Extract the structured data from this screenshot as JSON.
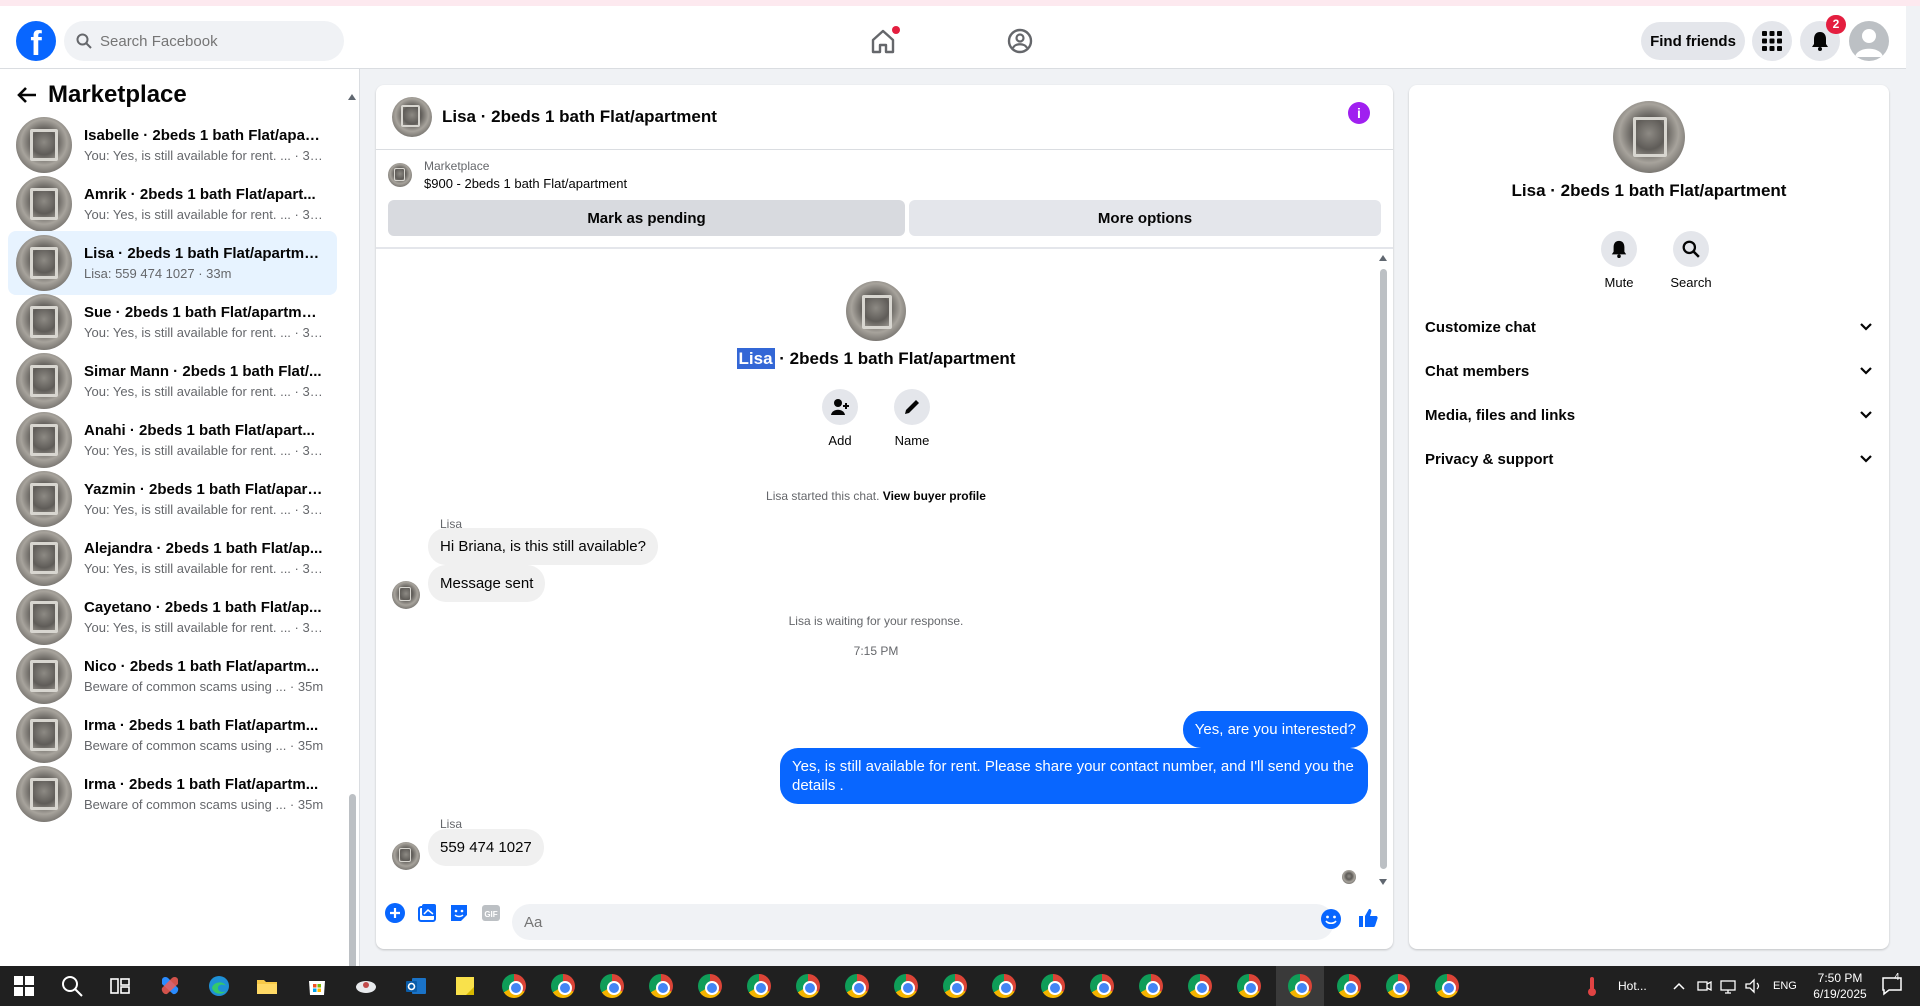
{
  "header": {
    "search_placeholder": "Search Facebook",
    "find_friends": "Find friends",
    "notification_count": "2"
  },
  "sidebar": {
    "title": "Marketplace",
    "conversations": [
      {
        "title": "Isabelle · 2beds 1 bath Flat/apart...",
        "sub": "You: Yes, is still available for rent. ... · 33m"
      },
      {
        "title": "Amrik · 2beds 1 bath Flat/apart...",
        "sub": "You: Yes, is still available for rent. ... · 33m"
      },
      {
        "title": "Lisa · 2beds 1 bath Flat/apartment",
        "sub": "Lisa: 559 474 1027 · 33m"
      },
      {
        "title": "Sue · 2beds 1 bath Flat/apartment",
        "sub": "You: Yes, is still available for rent. ... · 33m"
      },
      {
        "title": "Simar Mann · 2beds 1 bath Flat/...",
        "sub": "You: Yes, is still available for rent. ... · 34m"
      },
      {
        "title": "Anahi · 2beds 1 bath Flat/apart...",
        "sub": "You: Yes, is still available for rent. ... · 34m"
      },
      {
        "title": "Yazmin · 2beds 1 bath Flat/apart...",
        "sub": "You: Yes, is still available for rent. ... · 35m"
      },
      {
        "title": "Alejandra · 2beds 1 bath Flat/ap...",
        "sub": "You: Yes, is still available for rent. ... · 35m"
      },
      {
        "title": "Cayetano · 2beds 1 bath Flat/ap...",
        "sub": "You: Yes, is still available for rent. ... · 35m"
      },
      {
        "title": "Nico · 2beds 1 bath Flat/apartm...",
        "sub": "Beware of common scams using ... · 35m"
      },
      {
        "title": "Irma · 2beds 1 bath Flat/apartm...",
        "sub": "Beware of common scams using ... · 35m"
      },
      {
        "title": "Irma · 2beds 1 bath Flat/apartm...",
        "sub": "Beware of common scams using ... · 35m"
      }
    ]
  },
  "chat": {
    "title": "Lisa · 2beds 1 bath Flat/apartment",
    "marketplace_label": "Marketplace",
    "listing": "$900 - 2beds 1 bath Flat/apartment",
    "mark_pending": "Mark as pending",
    "more_options": "More options",
    "intro_name_highlight": "Lisa",
    "intro_name_rest": " · 2beds 1 bath Flat/apartment",
    "add_label": "Add",
    "name_label": "Name",
    "started_text": "Lisa started this chat. ",
    "view_buyer": "View buyer profile",
    "sender_name": "Lisa",
    "msg1": "Hi Briana, is this still available?",
    "msg2": "Message sent",
    "waiting": "Lisa is waiting for your response.",
    "time": "7:15 PM",
    "out1": "Yes, are you interested?",
    "out2": "Yes, is still available for rent. Please share your contact number, and I'll send you the details .",
    "sender_name2": "Lisa",
    "msg3": "559 474 1027",
    "composer_placeholder": "Aa"
  },
  "details": {
    "name": "Lisa · 2beds 1 bath Flat/apartment",
    "mute": "Mute",
    "search": "Search",
    "sections": [
      "Customize chat",
      "Chat members",
      "Media, files and links",
      "Privacy & support"
    ]
  },
  "taskbar": {
    "weather": "Hot...",
    "lang": "ENG",
    "time": "7:50 PM",
    "date": "6/19/2025",
    "notif": "4"
  },
  "colors": {
    "accent": "#0866ff",
    "highlight": "#3367d6",
    "info": "#a020f0"
  }
}
